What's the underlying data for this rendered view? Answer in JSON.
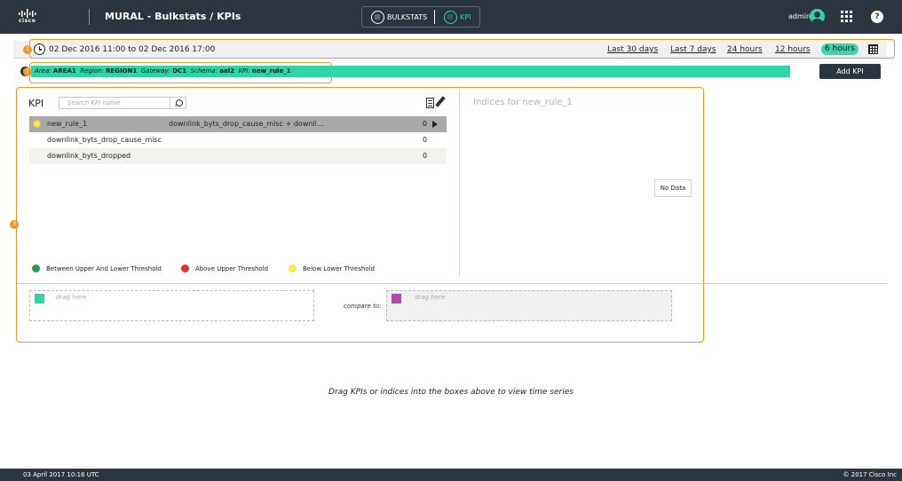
{
  "header": {
    "brand": "cisco",
    "title": "MURAL - Bulkstats / KPIs",
    "modes": [
      {
        "label": "BULKSTATS",
        "active": false
      },
      {
        "label": "KPI",
        "active": true
      }
    ],
    "user": "admin",
    "help": "?"
  },
  "timebar": {
    "range": "02 Dec 2016 11:00 to 02 Dec 2016 17:00",
    "presets": [
      "Last 30 days",
      "Last 7 days",
      "24 hours",
      "12 hours"
    ],
    "active_preset": "6 hours"
  },
  "filters": {
    "area_label": "Area:",
    "area_value": "AREA1",
    "region_label": "Region:",
    "region_value": "REGION1",
    "gateway_label": "Gateway:",
    "gateway_value": "DC1",
    "schema_label": "Schema:",
    "schema_value": "aal2",
    "kpi_label": "KPI:",
    "kpi_value": "new_rule_1",
    "add_button": "Add KPI"
  },
  "annotations": [
    "1",
    "2",
    "3"
  ],
  "kpi_panel": {
    "title": "KPI",
    "search_placeholder": "Search KPI name",
    "rows": [
      {
        "name": "new_rule_1",
        "formula": "downlink_byts_drop_cause_misc + downli...",
        "count": "0",
        "status_color": "#f6e949"
      },
      {
        "name": "downlink_byts_drop_cause_misc",
        "formula": "",
        "count": "0"
      },
      {
        "name": "downlink_byts_dropped",
        "formula": "",
        "count": "0"
      }
    ],
    "legend": [
      {
        "label": "Between Upper And Lower Threshold",
        "color": "#2e9a4e"
      },
      {
        "label": "Above Upper Threshold",
        "color": "#e0312d"
      },
      {
        "label": "Below Lower Threshold",
        "color": "#f6e949"
      }
    ]
  },
  "indices_panel": {
    "title": "Indices for new_rule_1",
    "empty": "No Data"
  },
  "compare": {
    "left_drop": "drag here",
    "left_color": "#2fd5a6",
    "label": "compare to:",
    "right_drop": "drag here",
    "right_color": "#b847b4"
  },
  "hint": "Drag KPIs or indices into the boxes above to view time series",
  "footer": {
    "timestamp": "03 April 2017 10:16 UTC",
    "copyright": "© 2017 Cisco Inc"
  },
  "colors": {
    "header_bg": "#2b3540",
    "accent": "#2fd5a6",
    "annotation": "#f0972a"
  }
}
